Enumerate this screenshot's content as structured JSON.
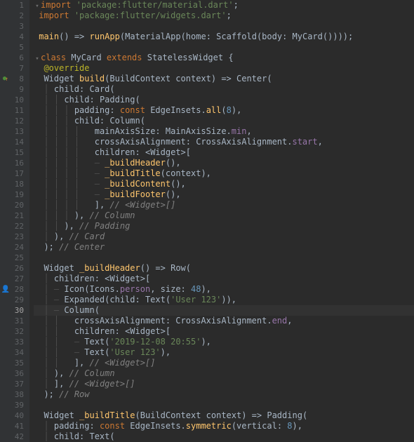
{
  "total_lines": 42,
  "current_line": 30,
  "mark_line": 8,
  "author_mark_line": 28,
  "lines": {
    "l1": {
      "import": "import",
      "str": "'package:flutter/material.dart'",
      "semi": ";"
    },
    "l2": {
      "import": "import",
      "str": "'package:flutter/widgets.dart'",
      "semi": ";"
    },
    "l4": {
      "main": "main",
      "arrow": "() => ",
      "runApp": "runApp",
      "p1": "(",
      "matApp": "MaterialApp",
      "p2": "(home: ",
      "scaf": "Scaffold",
      "p3": "(body: ",
      "mycard": "MyCard",
      "p4": "())));"
    },
    "l6": {
      "class": "class",
      "name": " MyCard ",
      "extends": "extends",
      "sup": " StatelessWidget {"
    },
    "l7": {
      "ann": "@override"
    },
    "l8": {
      "ret": "Widget ",
      "fn": "build",
      "params": "(BuildContext context) => ",
      "center": "Center",
      "p": "("
    },
    "l9": {
      "lbl": "child: ",
      "w": "Card",
      "p": "("
    },
    "l10": {
      "lbl": "child: ",
      "w": "Padding",
      "p": "("
    },
    "l11": {
      "lbl": "padding: ",
      "const": "const ",
      "w": "EdgeInsets",
      "dot": ".",
      "m": "all",
      "p": "(",
      "n": "8",
      "p2": "),"
    },
    "l12": {
      "lbl": "child: ",
      "w": "Column",
      "p": "("
    },
    "l13": {
      "lbl": "mainAxisSize: MainAxisSize.",
      "v": "min",
      "c": ","
    },
    "l14": {
      "lbl": "crossAxisAlignment: CrossAxisAlignment.",
      "v": "start",
      "c": ","
    },
    "l15": {
      "lbl": "children: ",
      "t": "<Widget>[",
      "c": ""
    },
    "l16": {
      "fn": "_buildHeader",
      "p": "(),"
    },
    "l17": {
      "fn": "_buildTitle",
      "p": "(context),"
    },
    "l18": {
      "fn": "_buildContent",
      "p": "(),"
    },
    "l19": {
      "fn": "_buildFooter",
      "p": "(),"
    },
    "l20": {
      "b": "], ",
      "c": "// <Widget>[]"
    },
    "l21": {
      "b": "), ",
      "c": "// Column"
    },
    "l22": {
      "b": "), ",
      "c": "// Padding"
    },
    "l23": {
      "b": "), ",
      "c": "// Card"
    },
    "l24": {
      "b": "); ",
      "c": "// Center"
    },
    "l26": {
      "ret": "Widget ",
      "fn": "_buildHeader",
      "params": "() => ",
      "w": "Row",
      "p": "("
    },
    "l27": {
      "lbl": "children: ",
      "t": "<Widget>[",
      "c": ""
    },
    "l28": {
      "w": "Icon",
      "p": "(Icons.",
      "ic": "person",
      "p2": ", size: ",
      "n": "48",
      "p3": "),"
    },
    "l29": {
      "w": "Expanded",
      "p": "(child: ",
      "w2": "Text",
      "p2": "(",
      "s": "'User 123'",
      "p3": ")),"
    },
    "l30": {
      "w": "Column",
      "p": "("
    },
    "l31": {
      "lbl": "crossAxisAlignment: CrossAxisAlignment.",
      "v": "end",
      "c": ","
    },
    "l32": {
      "lbl": "children: ",
      "t": "<Widget>[",
      "c": ""
    },
    "l33": {
      "w": "Text",
      "p": "(",
      "s": "'2019-12-08 20:55'",
      "p2": "),"
    },
    "l34": {
      "w": "Text",
      "p": "(",
      "s": "'User 123'",
      "p2": "),"
    },
    "l35": {
      "b": "], ",
      "c": "// <Widget>[]"
    },
    "l36": {
      "b": "), ",
      "c": "// Column"
    },
    "l37": {
      "b": "], ",
      "c": "// <Widget>[]"
    },
    "l38": {
      "b": "); ",
      "c": "// Row"
    },
    "l40": {
      "ret": "Widget ",
      "fn": "_buildTitle",
      "params": "(BuildContext context) => ",
      "w": "Padding",
      "p": "("
    },
    "l41": {
      "lbl": "padding: ",
      "const": "const ",
      "w": "EdgeInsets",
      "dot": ".",
      "m": "symmetric",
      "p": "(vertical: ",
      "n": "8",
      "p2": "),"
    },
    "l42": {
      "lbl": "child: ",
      "w": "Text",
      "p": "("
    }
  }
}
